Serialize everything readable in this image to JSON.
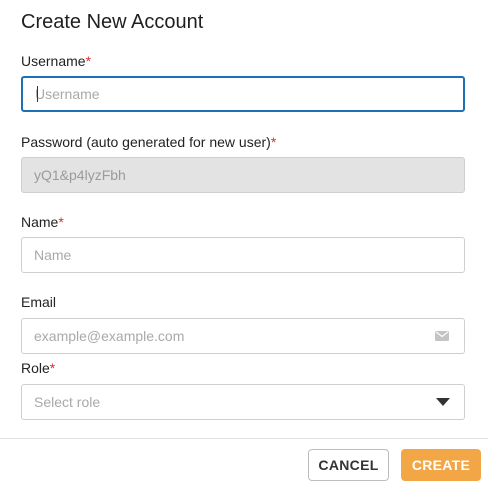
{
  "dialog": {
    "title": "Create New Account"
  },
  "fields": {
    "username": {
      "label": "Username",
      "required": "*",
      "placeholder": "Username",
      "value": ""
    },
    "password": {
      "label": "Password (auto generated for new user)",
      "required": "*",
      "value": "yQ1&p4lyzFbh"
    },
    "name": {
      "label": "Name",
      "required": "*",
      "placeholder": "Name",
      "value": ""
    },
    "email": {
      "label": "Email",
      "placeholder": "example@example.com",
      "value": "",
      "icon": "email-icon"
    },
    "role": {
      "label": "Role",
      "required": "*",
      "placeholder": "Select role",
      "icon": "chevron-down-icon"
    }
  },
  "actions": {
    "cancel_label": "CANCEL",
    "create_label": "CREATE"
  },
  "colors": {
    "accent": "#f3a646",
    "focus": "#1f6fb5",
    "required": "#d32f2f"
  }
}
